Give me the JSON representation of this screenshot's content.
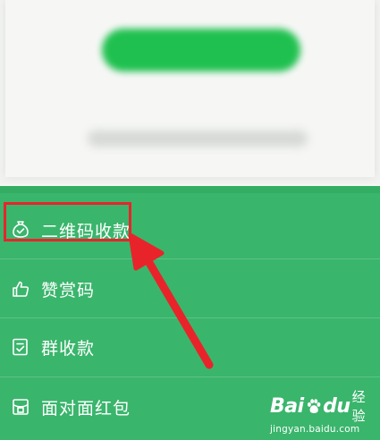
{
  "menu": {
    "items": [
      {
        "label": "二维码收款",
        "icon": "money-bag-icon",
        "highlighted": true
      },
      {
        "label": "赞赏码",
        "icon": "thumbs-up-icon",
        "highlighted": false
      },
      {
        "label": "群收款",
        "icon": "group-payment-icon",
        "highlighted": false
      },
      {
        "label": "面对面红包",
        "icon": "red-packet-icon",
        "highlighted": false
      }
    ]
  },
  "watermark": {
    "brand_bai": "Bai",
    "brand_du": "du",
    "brand_jingyan": "经验",
    "url": "jingyan.baidu.com"
  },
  "colors": {
    "panel_green": "#3ab56c",
    "button_green": "#1fc04f",
    "annotation_red": "#e8242a"
  }
}
